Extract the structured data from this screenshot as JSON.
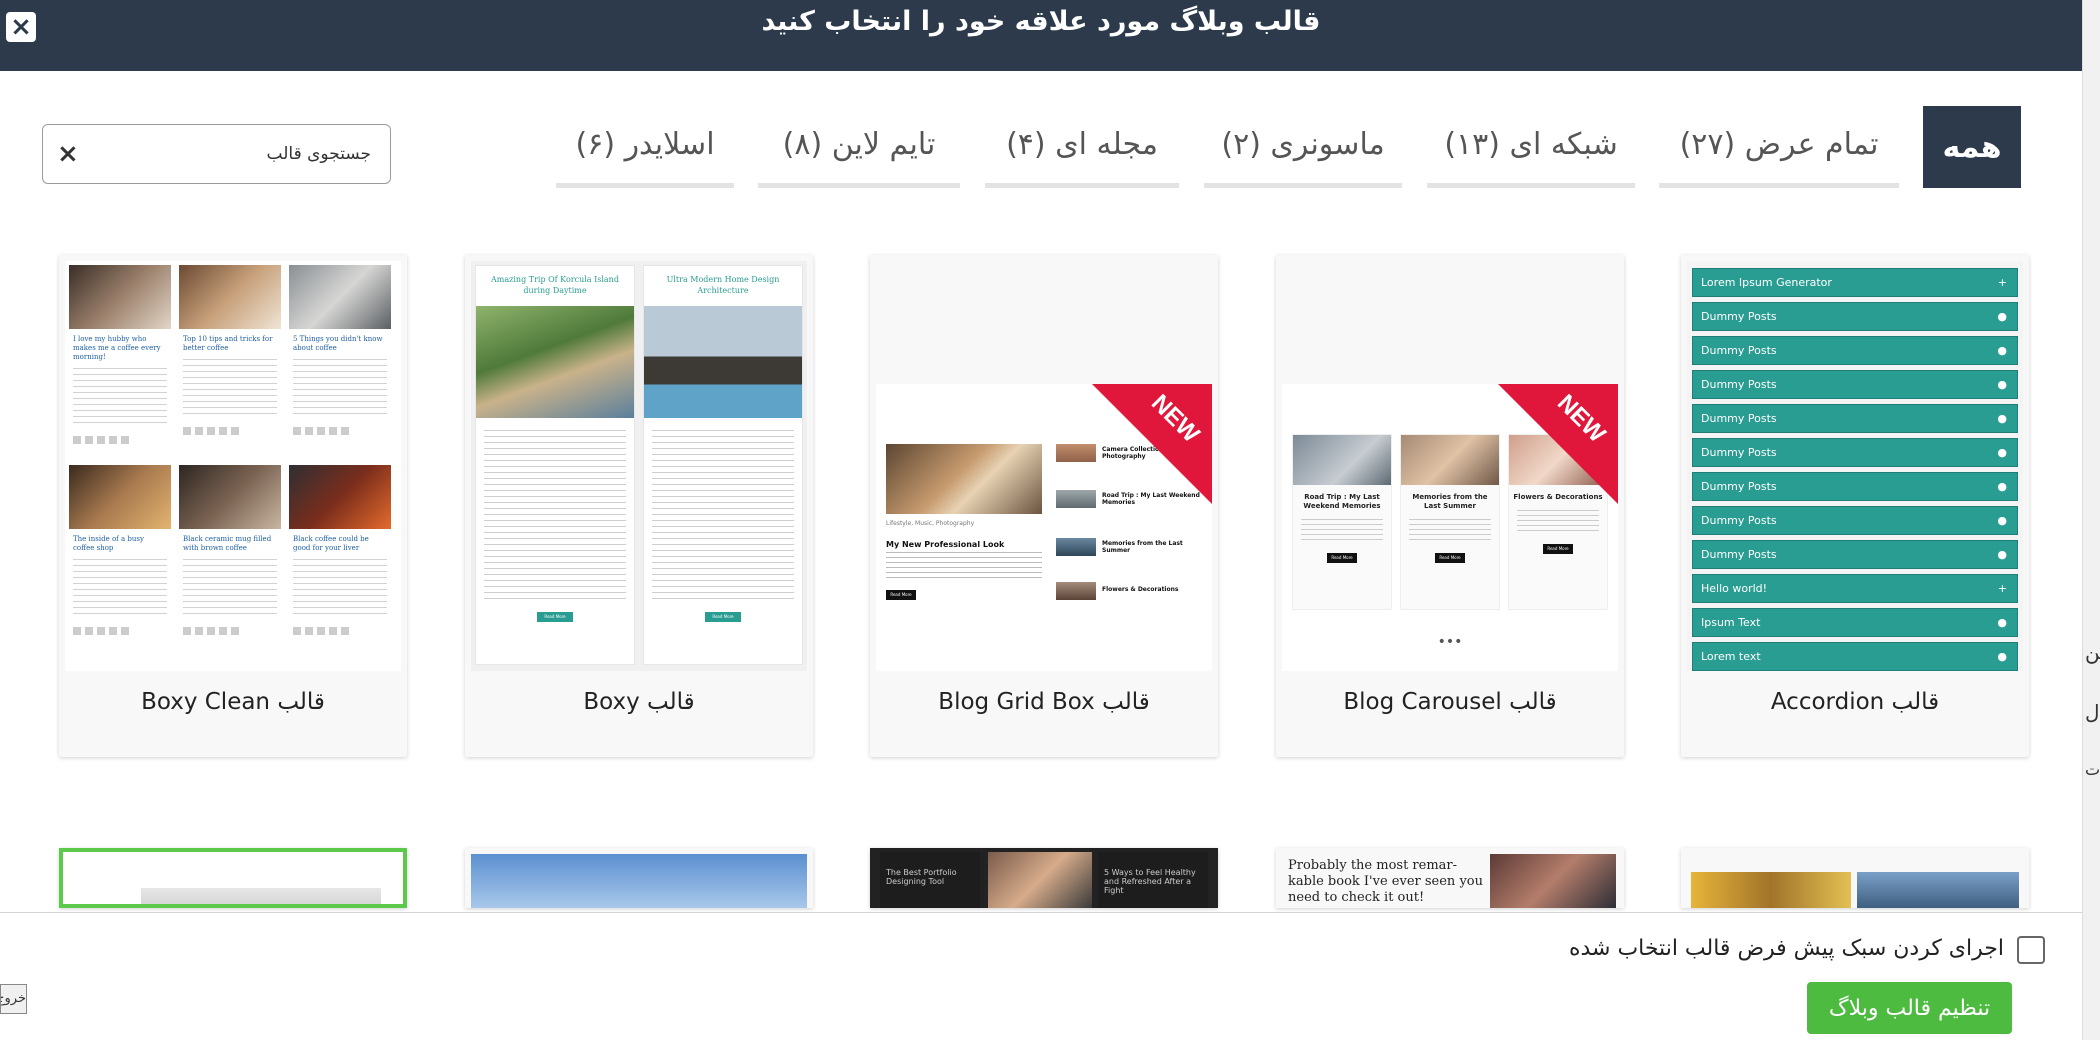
{
  "header": {
    "title": "قالب وبلاگ مورد علاقه خود را انتخاب کنید",
    "close_label": "×"
  },
  "search": {
    "placeholder": "جستجوی قالب",
    "clear_label": "×"
  },
  "tabs": [
    {
      "label": "همه",
      "active": true
    },
    {
      "label": "تمام عرض (۲۷)"
    },
    {
      "label": "شبکه ای (۱۳)"
    },
    {
      "label": "ماسونری (۲)"
    },
    {
      "label": "مجله ای (۴)"
    },
    {
      "label": "تایم لاین (۸)"
    },
    {
      "label": "اسلایدر (۶)"
    }
  ],
  "cards": [
    {
      "label": "قالب Accordion",
      "items": [
        "Lorem Ipsum Generator",
        "Dummy Posts",
        "Dummy Posts",
        "Dummy Posts",
        "Dummy Posts",
        "Dummy Posts",
        "Dummy Posts",
        "Dummy Posts",
        "Dummy Posts",
        "Hello world!",
        "Ipsum Text",
        "Lorem text"
      ]
    },
    {
      "label": "قالب Blog Carousel",
      "ribbon": "NEW",
      "posts": [
        "Road Trip : My Last Weekend Memories",
        "Memories from the Last Summer",
        "Flowers & Decorations"
      ],
      "button": "Read More"
    },
    {
      "label": "قالب Blog Grid Box",
      "ribbon": "NEW",
      "main_post": "My New Professional Look",
      "side_posts": [
        "Camera Collection: Girl Photography",
        "Road Trip : My Last Weekend Memories",
        "Memories from the Last Summer",
        "Flowers & Decorations"
      ],
      "button": "Read More"
    },
    {
      "label": "قالب Boxy",
      "posts": [
        "Amazing Trip Of Korcula Island during Daytime",
        "Ultra Modern Home Design Architecture"
      ],
      "button": "Read More"
    },
    {
      "label": "قالب Boxy Clean",
      "posts": [
        "I love my hubby who makes me a coffee every morning!",
        "Top 10 tips and tricks for better coffee",
        "5 Things you didn't know about coffee",
        "The inside of a busy coffee shop",
        "Black ceramic mug filled with brown coffee",
        "Black coffee could be good for your liver"
      ]
    }
  ],
  "row2": {
    "texts": [
      "Probably the most remar-kable book I've ever seen you need to check it out!",
      "The Best Portfolio Designing Tool",
      "5 Ways to Feel Healthy and Refreshed After a Fight"
    ]
  },
  "footer": {
    "default_style_label": "اجرای کردن سبک پیش فرض قالب انتخاب شده",
    "set_button": "تنظیم قالب وبلاگ",
    "exit_button": "خروج"
  },
  "edge_fragments": [
    "این",
    "ل",
    "ت"
  ],
  "colors": {
    "header": "#2c3a4b",
    "accent_green": "#4cbb3f",
    "accordion_teal": "#2a9d93",
    "ribbon_red": "#e0163a"
  }
}
